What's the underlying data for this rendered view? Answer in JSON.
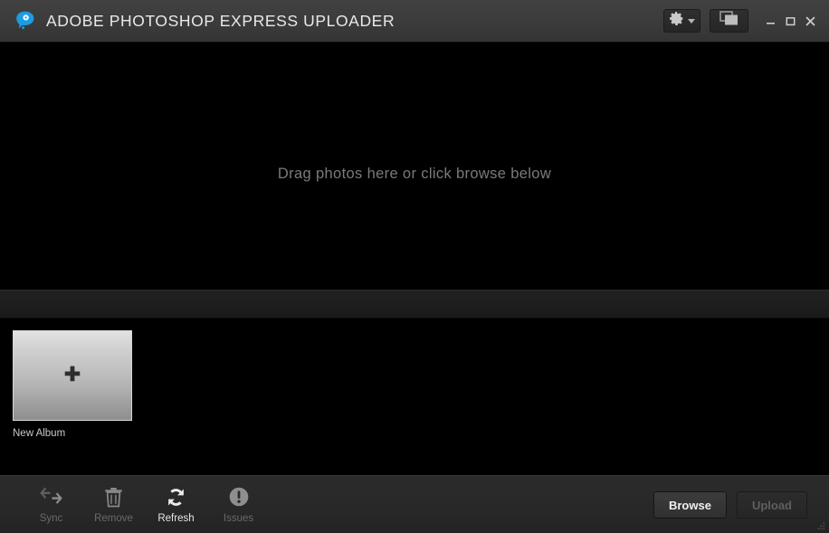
{
  "window": {
    "title": "ADOBE PHOTOSHOP EXPRESS UPLOADER",
    "logo_icon": "photoshop-express-bubble-icon",
    "settings_button": {
      "icon": "gear-icon",
      "caret_icon": "chevron-down-icon"
    },
    "panel_button": {
      "icon": "windows-panel-icon"
    },
    "controls": {
      "minimize": "–",
      "maximize": "□",
      "close": "✕"
    },
    "resize_grip_icon": "resize-grip-icon"
  },
  "dropzone": {
    "message": "Drag photos here or click browse below"
  },
  "albums": [
    {
      "label": "New Album",
      "icon": "plus-icon"
    }
  ],
  "toolbar": {
    "tools": [
      {
        "label": "Sync",
        "icon": "sync-arrows-icon",
        "enabled": false
      },
      {
        "label": "Remove",
        "icon": "trash-icon",
        "enabled": false
      },
      {
        "label": "Refresh",
        "icon": "refresh-circle-icon",
        "enabled": true
      },
      {
        "label": "Issues",
        "icon": "alert-circle-icon",
        "enabled": false
      }
    ],
    "actions": {
      "browse": {
        "label": "Browse",
        "enabled": true
      },
      "upload": {
        "label": "Upload",
        "enabled": false
      }
    }
  },
  "colors": {
    "accent": "#1b9ce3",
    "titlebar": "#3b3b3b",
    "canvas": "#000000",
    "toolbar": "#282828",
    "text_primary": "#e9e9e9",
    "text_dim": "#6a6a6a"
  }
}
